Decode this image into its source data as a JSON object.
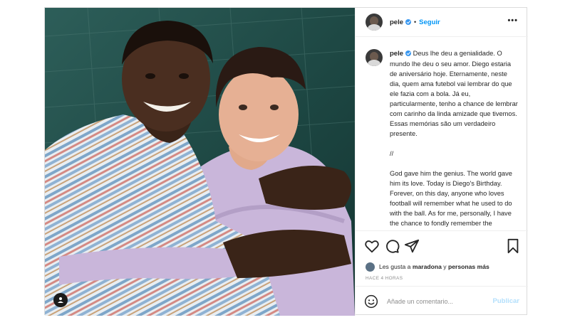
{
  "post": {
    "username": "pele",
    "follow_label": "Seguir",
    "separator": "•",
    "more_label": "•••",
    "caption": {
      "username": "pele",
      "pt": "Deus lhe deu a genialidade. O mundo lhe deu o seu amor. Diego estaria de aniversário hoje. Eternamente, neste dia, quem ama futebol vai lembrar do que ele fazia com a bola. Já eu, particularmente, tenho a chance de lembrar com carinho da linda amizade que tivemos. Essas memórias são um verdadeiro presente.",
      "divider": "//",
      "en": "God gave him the genius. The world gave him its love. Today is Diego's Birthday. Forever, on this day, anyone who loves football will remember what he used to do with the ball. As for me, personally, I have the chance to fondly remember the beautiful friendship we had."
    },
    "likes": {
      "prefix": "Les gusta a",
      "user": "maradona",
      "connector": "y",
      "others": "personas más"
    },
    "timestamp": "HACE 4 HORAS",
    "comment_placeholder": "Añade un comentario...",
    "publish_label": "Publicar",
    "icons": [
      "heart-icon",
      "comment-icon",
      "share-icon",
      "bookmark-icon",
      "emoji-icon",
      "user-tag-icon",
      "verified-badge-icon"
    ],
    "colors": {
      "link_blue": "#0095f6",
      "publish_disabled": "#b2dffc",
      "verified": "#3897f0"
    }
  }
}
